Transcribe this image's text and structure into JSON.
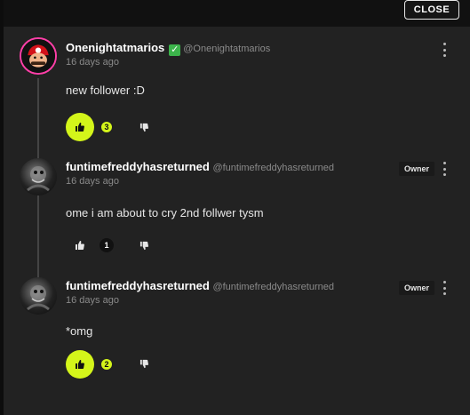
{
  "close_label": "CLOSE",
  "colors": {
    "accent": "#d4f51a",
    "avatar_ring": "#ff3fa8",
    "verified": "#3cb44b"
  },
  "comments": [
    {
      "name": "Onenightatmarios",
      "verified": true,
      "handle": "@Onenightatmarios",
      "time": "16 days ago",
      "text": "new follower :D",
      "likes": "3",
      "liked": true,
      "badge": ""
    },
    {
      "name": "funtimefreddyhasreturned",
      "verified": false,
      "handle": "@funtimefreddyhasreturned",
      "time": "16 days ago",
      "text": "ome i am about to cry 2nd follwer tysm",
      "likes": "1",
      "liked": false,
      "badge": "Owner"
    },
    {
      "name": "funtimefreddyhasreturned",
      "verified": false,
      "handle": "@funtimefreddyhasreturned",
      "time": "16 days ago",
      "text": "*omg",
      "likes": "2",
      "liked": true,
      "badge": "Owner"
    }
  ]
}
